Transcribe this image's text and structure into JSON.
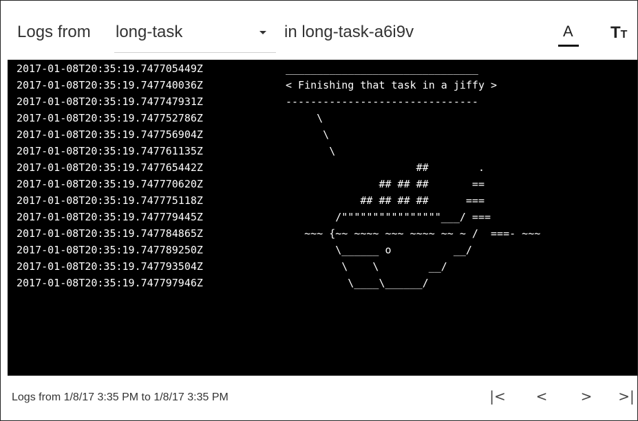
{
  "header": {
    "prefix": "Logs from",
    "container_selected": "long-task",
    "pod_text": "in long-task-a6i9v",
    "font_color_icon": "A",
    "text_size_icon_big": "T",
    "text_size_icon_small": "T"
  },
  "logs": [
    {
      "ts": "2017-01-08T20:35:19.747705449Z",
      "msg": "_______________________________"
    },
    {
      "ts": "2017-01-08T20:35:19.747740036Z",
      "msg": "< Finishing that task in a jiffy >"
    },
    {
      "ts": "2017-01-08T20:35:19.747747931Z",
      "msg": "-------------------------------"
    },
    {
      "ts": "2017-01-08T20:35:19.747752786Z",
      "msg": "     \\"
    },
    {
      "ts": "2017-01-08T20:35:19.747756904Z",
      "msg": "      \\"
    },
    {
      "ts": "2017-01-08T20:35:19.747761135Z",
      "msg": "       \\"
    },
    {
      "ts": "2017-01-08T20:35:19.747765442Z",
      "msg": "                     ##        ."
    },
    {
      "ts": "2017-01-08T20:35:19.747770620Z",
      "msg": "               ## ## ##       =="
    },
    {
      "ts": "2017-01-08T20:35:19.747775118Z",
      "msg": "            ## ## ## ##      ==="
    },
    {
      "ts": "2017-01-08T20:35:19.747779445Z",
      "msg": "        /\"\"\"\"\"\"\"\"\"\"\"\"\"\"\"\"___/ ==="
    },
    {
      "ts": "2017-01-08T20:35:19.747784865Z",
      "msg": "   ~~~ {~~ ~~~~ ~~~ ~~~~ ~~ ~ /  ===- ~~~"
    },
    {
      "ts": "2017-01-08T20:35:19.747789250Z",
      "msg": "        \\______ o          __/"
    },
    {
      "ts": "2017-01-08T20:35:19.747793504Z",
      "msg": "         \\    \\        __/"
    },
    {
      "ts": "2017-01-08T20:35:19.747797946Z",
      "msg": "          \\____\\______/"
    }
  ],
  "footer": {
    "range_text": "Logs from 1/8/17 3:35 PM to 1/8/17 3:35 PM",
    "first_page_label": "|<",
    "prev_page_label": "<",
    "next_page_label": ">",
    "last_page_label": ">|"
  }
}
